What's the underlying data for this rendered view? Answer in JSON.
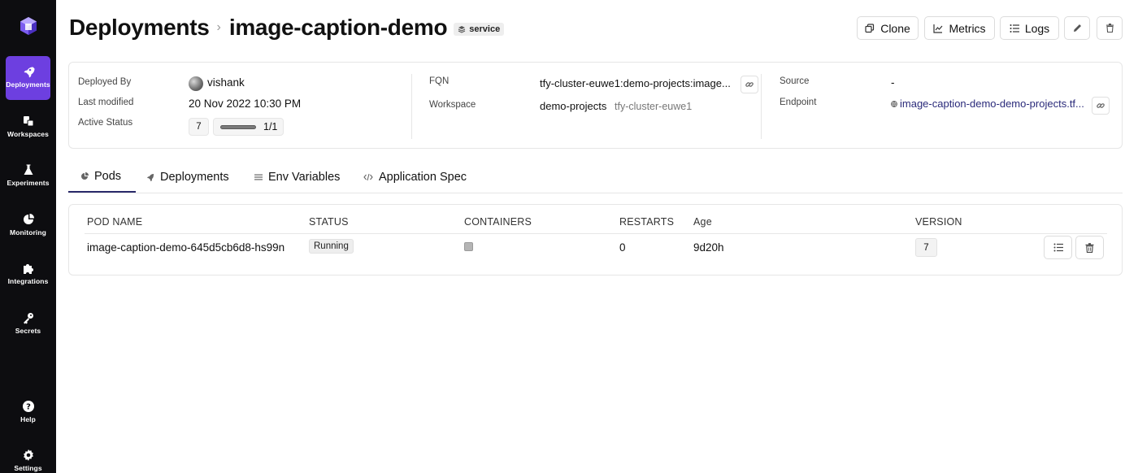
{
  "sidebar": {
    "items": [
      {
        "label": "Deployments",
        "icon": "rocket-icon",
        "active": true
      },
      {
        "label": "Workspaces",
        "icon": "workspaces-icon",
        "active": false
      },
      {
        "label": "Experiments",
        "icon": "flask-icon",
        "active": false
      },
      {
        "label": "Monitoring",
        "icon": "pie-chart-icon",
        "active": false
      },
      {
        "label": "Integrations",
        "icon": "puzzle-icon",
        "active": false
      },
      {
        "label": "Secrets",
        "icon": "key-icon",
        "active": false
      },
      {
        "label": "Help",
        "icon": "help-icon",
        "active": false
      },
      {
        "label": "Settings",
        "icon": "gear-icon",
        "active": false
      }
    ]
  },
  "header": {
    "breadcrumb_root": "Deployments",
    "title": "image-caption-demo",
    "type_badge": "service",
    "buttons": {
      "clone": "Clone",
      "metrics": "Metrics",
      "logs": "Logs"
    }
  },
  "info": {
    "deployed_by_label": "Deployed By",
    "deployed_by": "vishank",
    "last_modified_label": "Last modified",
    "last_modified": "20 Nov 2022 10:30 PM",
    "active_status_label": "Active Status",
    "active_version": "7",
    "active_pods": "1/1",
    "active_pods_fraction": 1.0,
    "fqn_label": "FQN",
    "fqn": "tfy-cluster-euwe1:demo-projects:image...",
    "workspace_label": "Workspace",
    "workspace": "demo-projects",
    "workspace_cluster": "tfy-cluster-euwe1",
    "source_label": "Source",
    "source": "-",
    "endpoint_label": "Endpoint",
    "endpoint": "image-caption-demo-demo-projects.tf..."
  },
  "tabs": [
    {
      "label": "Pods",
      "active": true
    },
    {
      "label": "Deployments",
      "active": false
    },
    {
      "label": "Env Variables",
      "active": false
    },
    {
      "label": "Application Spec",
      "active": false
    }
  ],
  "pods_table": {
    "columns": [
      "POD NAME",
      "STATUS",
      "CONTAINERS",
      "RESTARTS",
      "Age",
      "VERSION"
    ],
    "rows": [
      {
        "pod_name": "image-caption-demo-645d5cb6d8-hs99n",
        "status": "Running",
        "restarts": "0",
        "age": "9d20h",
        "version": "7"
      }
    ]
  },
  "colors": {
    "sidebar_bg": "#0d0d10",
    "accent": "#6d3fe0",
    "endpoint_link": "#2a2a7a"
  }
}
